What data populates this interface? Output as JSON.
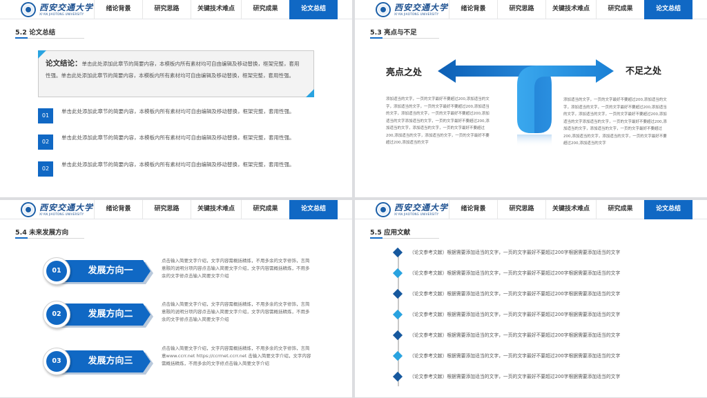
{
  "brand": {
    "name": "西安交通大学",
    "subtitle": "XI'AN JIAOTONG UNIVERSITY"
  },
  "colors": {
    "primary": "#1068c4",
    "light": "#29a3e0",
    "dark": "#16589e",
    "text": "#555555"
  },
  "nav": [
    "绪论背景",
    "研究思路",
    "关键技术难点",
    "研究成果",
    "论文总结"
  ],
  "nav_active": "论文总结",
  "slide1": {
    "title": "5.2 论文总结",
    "summary_label": "论文结论：",
    "summary_text": "单击此处添加此章节的简要内容，本模板内所有素材均可自由编辑及移动替换，框架完整，套用性强。单击此处添加此章节的简要内容，本模板内所有素材均可自由编辑及移动替换，框架完整，套用性强。",
    "items": [
      {
        "num": "01",
        "text": "单击此处添加此章节的简要内容，本模板内所有素材均可自由编辑及移动替换，框架完整，套用性强。"
      },
      {
        "num": "02",
        "text": "单击此处添加此章节的简要内容，本模板内所有素材均可自由编辑及移动替换，框架完整，套用性强。"
      },
      {
        "num": "02",
        "text": "单击此处添加此章节的简要内容，本模板内所有素材均可自由编辑及移动替换，框架完整，套用性强。"
      }
    ]
  },
  "slide2": {
    "title": "5.3 亮点与不足",
    "left_label": "亮点之处",
    "right_label": "不足之处",
    "left_text": "添加适当的文字，一页的文字最好不要超过200,添加适当的文字，添加适当的文字，一页的文字最好不要超过200,添加适当的文字，添加适当的文字，一页的文字最好不要超过200,添加适当的文字添加适当的文字，一页的文字最好不要超过200,添加适当的文字，添加适当的文字，一页的文字最好不要超过200,添加适当的文字，添加适当的文字，一页的文字最好不要超过200,添加适当的文字",
    "right_text": "添加适当的文字，一页的文字最好不要超过200,添加适当的文字，添加适当的文字，一页的文字最好不要超过200,添加适当的文字，添加适当的文字，一页的文字最好不要超过200,添加适当的文字添加适当的文字，一页的文字最好不要超过200,添加适当的文字，添加适当的文字，一页的文字最好不要超过200,添加适当的文字，添加适当的文字，一页的文字最好不要超过200,添加适当的文字"
  },
  "slide3": {
    "title": "5.4 未来发展方向",
    "directions": [
      {
        "num": "01",
        "label": "发展方向一",
        "text": "点击输入简要文字介绍，文字内容需概括精炼，不用多余的文字修饰，言简意赅的说明分项内容点击输入简要文字介绍，文字内容需概括精炼，不用多余的文字修点击输入简要文字介绍"
      },
      {
        "num": "02",
        "label": "发展方向二",
        "text": "点击输入简要文字介绍，文字内容需概括精炼，不用多余的文字修饰，言简意赅的说明分项内容点击输入简要文字介绍，文字内容需概括精炼，不用多余的文字修点击输入简要文字介绍"
      },
      {
        "num": "03",
        "label": "发展方向三",
        "text": "点击输入简要文字介绍，文字内容需概括精炼，不用多余的文字修饰，言简意www.ccrr.net https://ccrrnet.ccrr.net 击输入简要文字介绍，文字内容需概括精炼，不用多余的文字修点击输入简要文字介绍"
      }
    ]
  },
  "slide4": {
    "title": "5.5 应用文献",
    "refs": [
      "（论文参考文献）根据需要添加适当的文字，一页的文字最好不要超过200字根据需要添加适当的文字",
      "（论文参考文献）根据需要添加适当的文字，一页的文字最好不要超过200字根据需要添加适当的文字",
      "（论文参考文献）根据需要添加适当的文字，一页的文字最好不要超过200字根据需要添加适当的文字",
      "（论文参考文献）根据需要添加适当的文字，一页的文字最好不要超过200字根据需要添加适当的文字",
      "（论文参考文献）根据需要添加适当的文字，一页的文字最好不要超过200字根据需要添加适当的文字",
      "（论文参考文献）根据需要添加适当的文字，一页的文字最好不要超过200字根据需要添加适当的文字",
      "（论文参考文献）根据需要添加适当的文字，一页的文字最好不要超过200字根据需要添加适当的文字"
    ]
  }
}
